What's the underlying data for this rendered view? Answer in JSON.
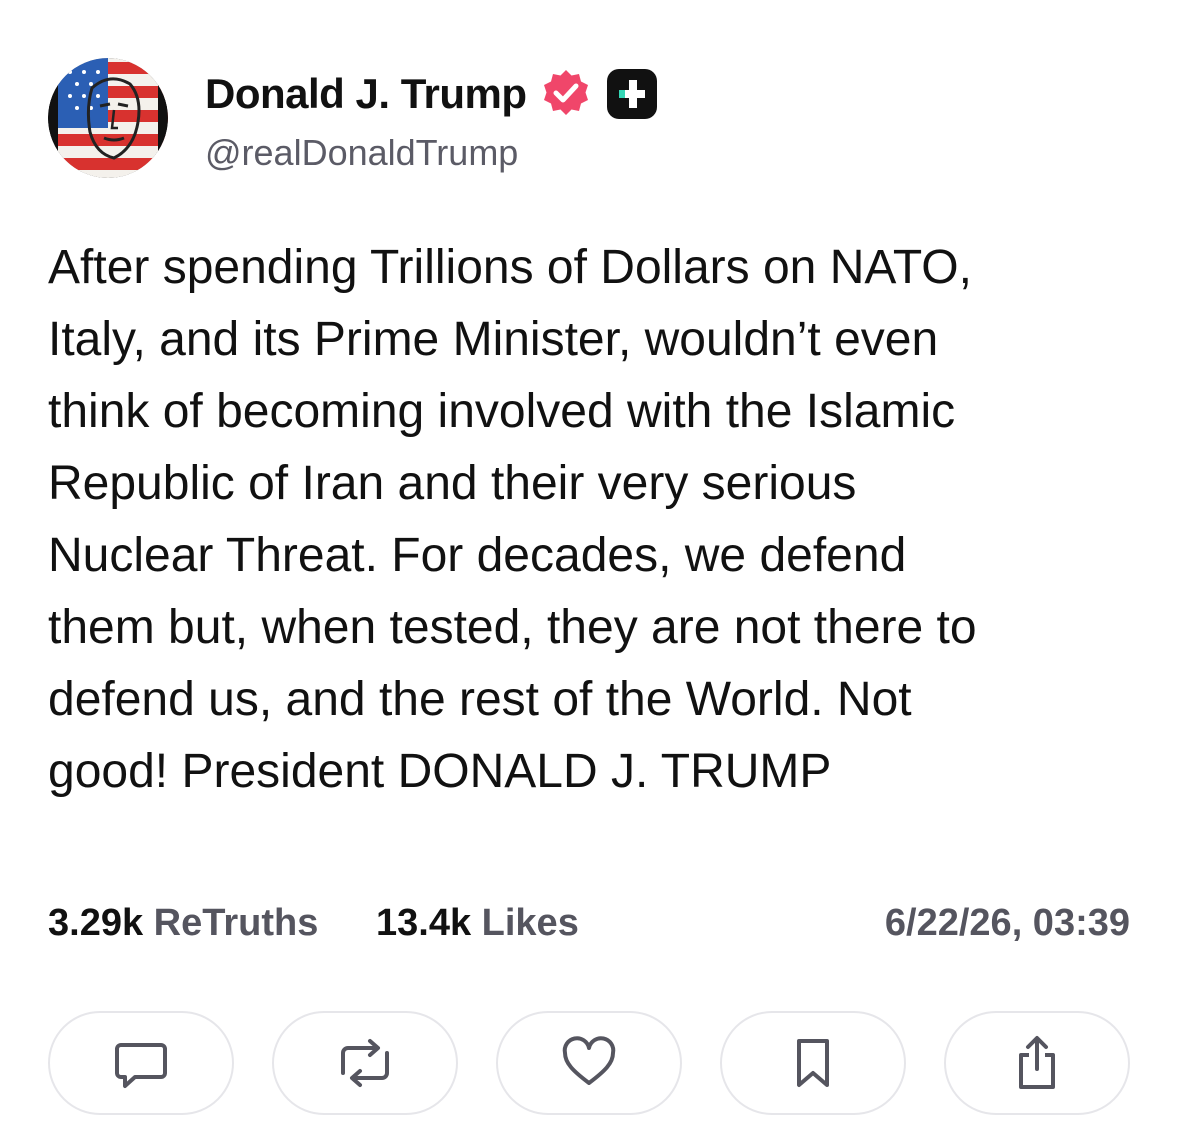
{
  "profile": {
    "display_name": "Donald J. Trump",
    "handle": "@realDonaldTrump",
    "avatar_icon": "avatar-flag-portrait",
    "verified_icon": "verified-badge-icon",
    "plus_icon": "truth-plus-badge-icon"
  },
  "post": {
    "lines": [
      "After spending Trillions of Dollars on NATO,",
      "Italy, and its Prime Minister, wouldn’t even",
      "think of becoming involved with the Islamic",
      "Republic of Iran and their very serious",
      "Nuclear Threat. For decades, we defend",
      "them but, when tested, they are not there to",
      "defend us, and the rest of the World. Not",
      "good! President DONALD J. TRUMP"
    ]
  },
  "stats": {
    "retruths_count": "3.29k",
    "retruths_label": "ReTruths",
    "likes_count": "13.4k",
    "likes_label": "Likes",
    "timestamp": "6/22/26, 03:39"
  },
  "actions": [
    {
      "name": "reply",
      "icon": "comment-icon"
    },
    {
      "name": "retruth",
      "icon": "retruth-icon"
    },
    {
      "name": "like",
      "icon": "heart-icon"
    },
    {
      "name": "bookmark",
      "icon": "bookmark-icon"
    },
    {
      "name": "share",
      "icon": "share-icon"
    }
  ],
  "colors": {
    "verified": "#f0466a",
    "plus_badge": "#111111",
    "plus_accent": "#34d6b5",
    "muted_text": "#55555f",
    "button_border": "#e6e6ea"
  }
}
